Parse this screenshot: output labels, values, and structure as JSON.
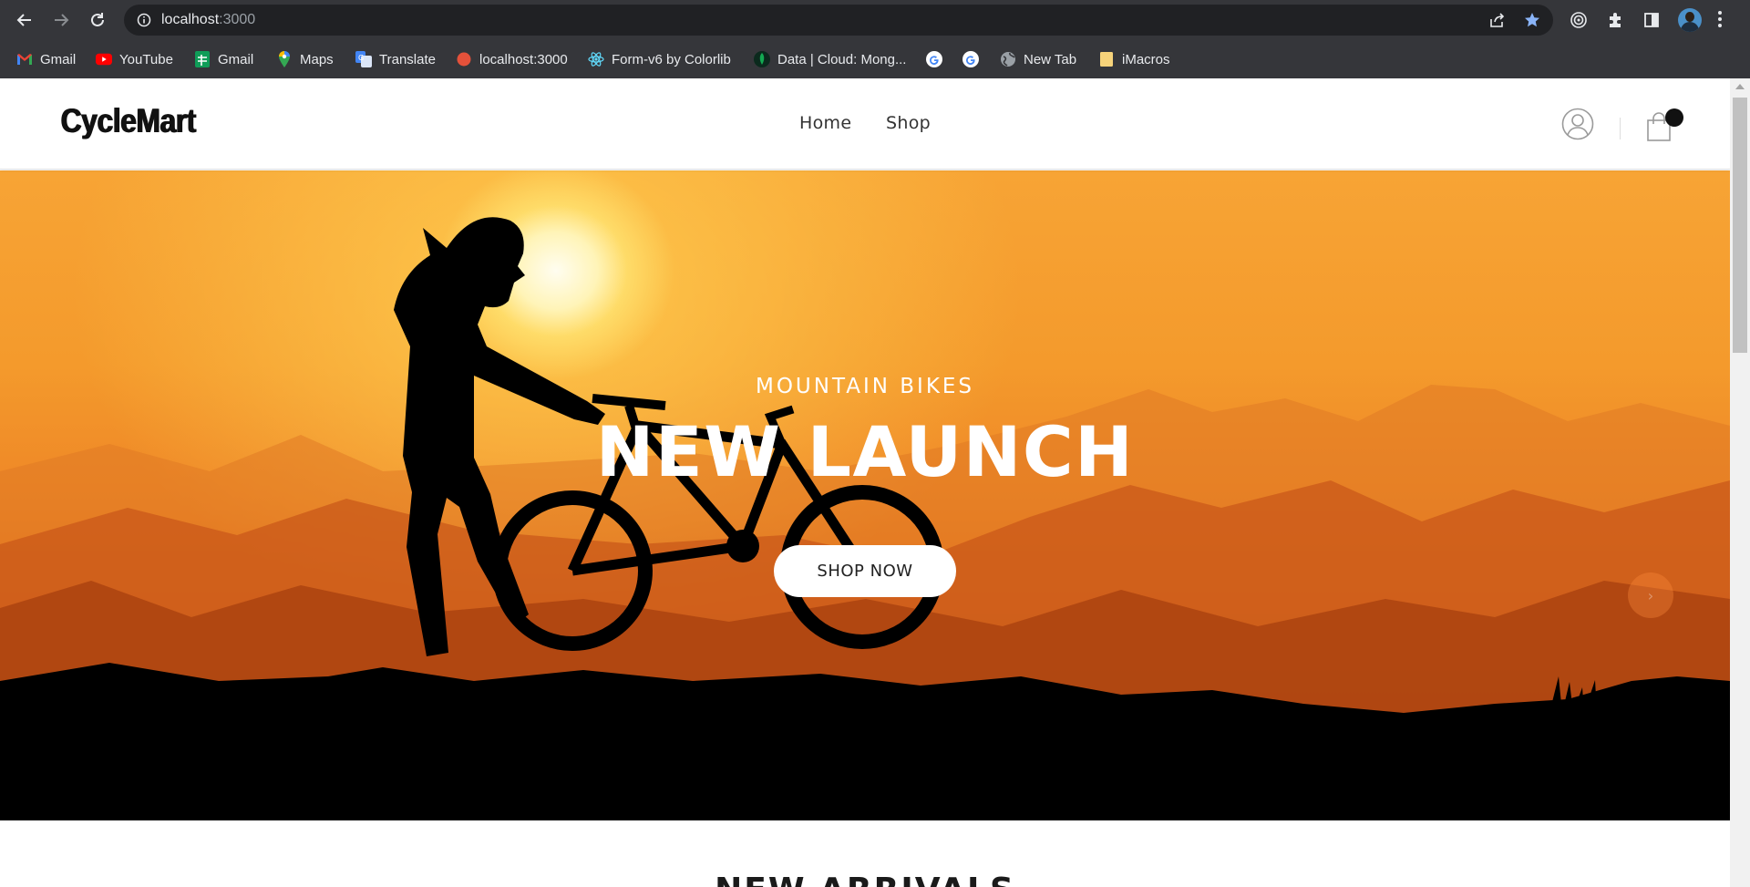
{
  "browser": {
    "url_host": "localhost",
    "url_port": ":3000",
    "bookmarks": [
      {
        "label": "Gmail",
        "icon": "gmail-icon"
      },
      {
        "label": "YouTube",
        "icon": "youtube-icon"
      },
      {
        "label": "Gmail",
        "icon": "sheets-icon"
      },
      {
        "label": "Maps",
        "icon": "maps-icon"
      },
      {
        "label": "Translate",
        "icon": "translate-icon"
      },
      {
        "label": "localhost:3000",
        "icon": "red-dot-icon"
      },
      {
        "label": "Form-v6 by Colorlib",
        "icon": "react-icon"
      },
      {
        "label": "Data | Cloud: Mong...",
        "icon": "mongodb-leaf-icon"
      },
      {
        "label": "",
        "icon": "google-icon"
      },
      {
        "label": "",
        "icon": "google-icon"
      },
      {
        "label": "New Tab",
        "icon": "globe-icon"
      },
      {
        "label": "iMacros",
        "icon": "folder-icon"
      }
    ]
  },
  "site": {
    "logo": "CycleMart",
    "menu": [
      "Home",
      "Shop"
    ]
  },
  "hero": {
    "subtitle": "MOUNTAIN BIKES",
    "title": "NEW LAUNCH",
    "cta": "SHOP NOW",
    "next_arrow": "›"
  },
  "sections": {
    "new_arrivals": "NEW ARRIVALS"
  },
  "colors": {
    "browser_chrome": "#35363a",
    "omnibox": "#202124",
    "hero_sky_top": "#f7a435",
    "hero_sky_bottom": "#c0500f",
    "silhouette": "#000000",
    "cart_badge": "#111111"
  }
}
